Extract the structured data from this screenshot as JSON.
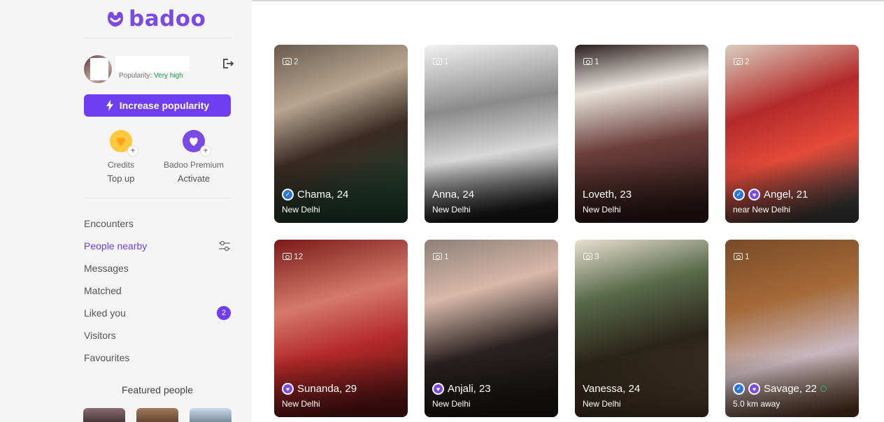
{
  "brand": {
    "name": "badoo",
    "color": "#7a49e6"
  },
  "profile": {
    "popularity_label": "Popularity:",
    "popularity_value": "Very high",
    "popularity_color": "#1b9f4a"
  },
  "actions": {
    "increase_popularity": "Increase popularity",
    "logout_icon": "logout-icon"
  },
  "wallet": [
    {
      "label": "Credits",
      "action": "Top up",
      "icon": "coin-heart-icon",
      "color": "#ffc83d"
    },
    {
      "label": "Badoo Premium",
      "action": "Activate",
      "icon": "premium-heart-icon",
      "color": "#7a49e6"
    }
  ],
  "nav": {
    "items": [
      {
        "label": "Encounters"
      },
      {
        "label": "People nearby",
        "active": true,
        "icon": "filters-icon"
      },
      {
        "label": "Messages"
      },
      {
        "label": "Matched"
      },
      {
        "label": "Liked you",
        "badge": "2"
      },
      {
        "label": "Visitors"
      },
      {
        "label": "Favourites"
      }
    ]
  },
  "featured": {
    "title": "Featured people"
  },
  "people": [
    {
      "photos": "2",
      "name": "Chama, 24",
      "location": "New Delhi",
      "verified": true
    },
    {
      "photos": "1",
      "name": "Anna, 24",
      "location": "New Delhi"
    },
    {
      "photos": "1",
      "name": "Loveth, 23",
      "location": "New Delhi"
    },
    {
      "photos": "2",
      "name": "Angel, 21",
      "location": "near New Delhi",
      "verified": true,
      "premium": true
    },
    {
      "photos": "12",
      "name": "Sunanda, 29",
      "location": "New Delhi",
      "premium": true
    },
    {
      "photos": "1",
      "name": "Anjali, 23",
      "location": "New Delhi",
      "premium": true
    },
    {
      "photos": "3",
      "name": "Vanessa, 24",
      "location": "New Delhi"
    },
    {
      "photos": "1",
      "name": "Savage, 22",
      "location": "5.0 km away",
      "verified": true,
      "premium": true,
      "online": true
    }
  ]
}
